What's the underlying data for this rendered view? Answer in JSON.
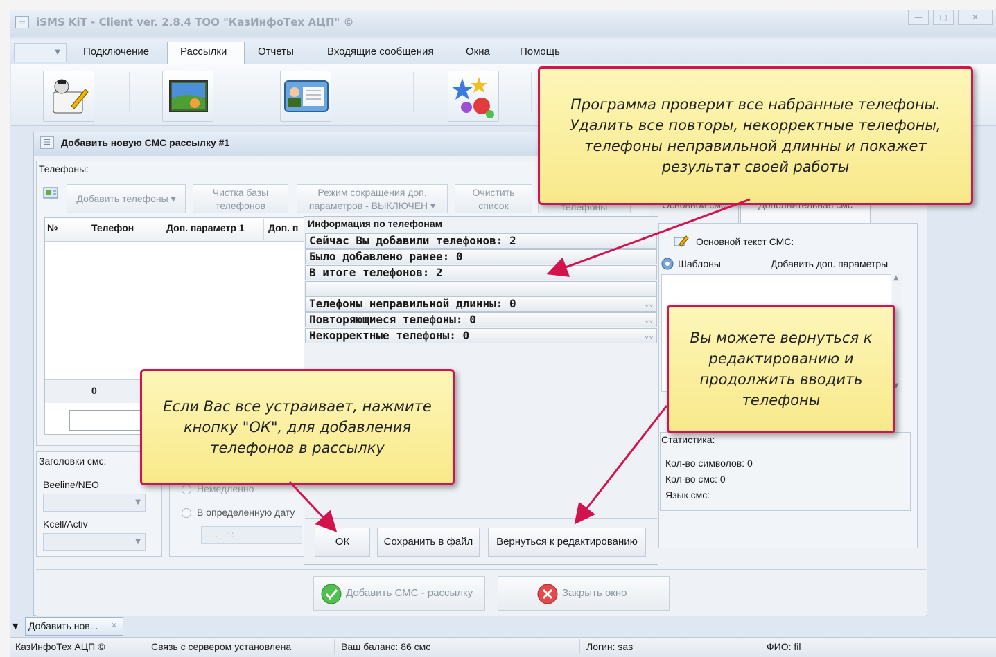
{
  "window": {
    "title": "iSMS KiT - Client ver. 2.8.4 ТОО \"КазИнфоТех АЦП\" ©"
  },
  "menu": {
    "items": [
      "Подключение",
      "Рассылки",
      "Отчеты",
      "Входящие сообщения",
      "Окна",
      "Помощь"
    ],
    "active": "Рассылки"
  },
  "panel": {
    "title": "Добавить новую СМС рассылку #1",
    "phones_label": "Телефоны:",
    "toolbar": {
      "add_phones": "Добавить телефоны",
      "clean_db_1": "Чистка базы",
      "clean_db_2": "телефонов",
      "mode_1": "Режим сокращения доп.",
      "mode_2": "параметров - ВЫКЛЮЧЕН",
      "clear_1": "Очистить",
      "clear_2": "список",
      "phones_tab": "телефоны"
    },
    "grid": {
      "columns": [
        "№",
        "Телефон",
        "Доп. параметр 1",
        "Доп. п"
      ],
      "total": "0"
    },
    "headers_group": {
      "label": "Заголовки смс:",
      "beeline": "Beeline/NEO",
      "kcell": "Kcell/Activ"
    },
    "schedule": {
      "immediate": "Немедленно",
      "specific_date": "В определенную дату",
      "date_value": ". .   : :"
    },
    "right": {
      "tab_main": "Основной смс",
      "tab_additional": "Дополнительная смс",
      "main_text_label": "Основной текст СМС:",
      "templates": "Шаблоны",
      "add_params": "Добавить доп. параметры",
      "stats_label": "Статистика:",
      "chars": "Кол-во символов: 0",
      "sms_count": "Кол-во смс: 0",
      "language": "Язык смс:"
    },
    "add_sms_button": "Добавить СМС - рассылку",
    "close_button": "Закрыть окно"
  },
  "info_dialog": {
    "title": "Информация по телефонам",
    "rows": [
      "Сейчас Вы добавили телефонов: 2",
      "Было добавлено ранее: 0",
      "В итоге телефонов: 2",
      "",
      "Телефоны неправильной длинны: 0",
      "Повторяющиеся телефоны: 0",
      "Некорректные телефоны: 0"
    ],
    "ok": "ОК",
    "save": "Сохранить в файл",
    "back": "Вернуться к редактированию"
  },
  "callouts": {
    "top": "Программа проверит все набранные телефоны. Удалить все повторы, некорректные телефоны, телефоны неправильной длинны и покажет результат своей работы",
    "right": "Вы можете вернуться к редактированию и продолжить вводить телефоны",
    "left": "Если Вас все устраивает, нажмите кнопку \"ОК\", для добавления телефонов в рассылку"
  },
  "taskbar": {
    "tab": "Добавить нов..."
  },
  "status": {
    "company": "КазИнфоТех АЦП ©",
    "connection": "Связь с сервером установлена",
    "balance": "Ваш баланс: 86 смс",
    "login": "Логин: sas",
    "fio": "ФИО: fil"
  },
  "colors": {
    "callout_border": "#d3134e",
    "callout_fill": "#fbef9f",
    "arrow": "#d3134e"
  }
}
